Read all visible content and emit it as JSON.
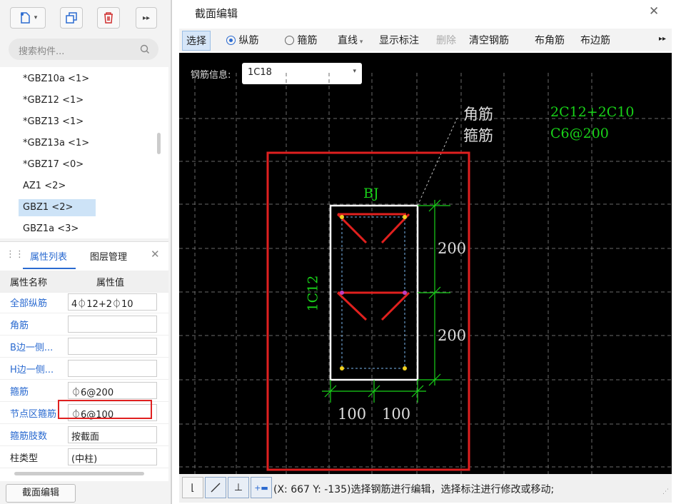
{
  "left": {
    "search_placeholder": "搜索构件...",
    "items": [
      "*GBZ10a <1>",
      "*GBZ12 <1>",
      "*GBZ13 <1>",
      "*GBZ13a <1>",
      "*GBZ17 <0>",
      "AZ1 <2>",
      "GBZ1 <2>",
      "GBZ1a <3>"
    ],
    "tabs": {
      "props": "属性列表",
      "layers": "图层管理"
    },
    "headers": {
      "name": "属性名称",
      "value": "属性值"
    },
    "rows": [
      {
        "name": "全部纵筋",
        "value": "4⏀12+2⏀10"
      },
      {
        "name": "角筋",
        "value": ""
      },
      {
        "name": "B边一侧...",
        "value": ""
      },
      {
        "name": "H边一侧...",
        "value": ""
      },
      {
        "name": "箍筋",
        "value": "⏀6@200"
      },
      {
        "name": "节点区箍筋",
        "value": "⏀6@100"
      },
      {
        "name": "箍筋肢数",
        "value": "按截面"
      },
      {
        "name": "柱类型",
        "value": "(中柱)"
      }
    ],
    "bottom_button": "截面编辑"
  },
  "dialog": {
    "title": "截面编辑",
    "toolbar": {
      "select": "选择",
      "longitudinal": "纵筋",
      "stirrup": "箍筋",
      "line": "直线",
      "show_label": "显示标注",
      "delete": "删除",
      "clear": "清空钢筋",
      "corner": "布角筋",
      "edge": "布边筋"
    },
    "rebar_info_label": "钢筋信息:",
    "rebar_info_value": "1C18",
    "canvas": {
      "corner_label": "角筋",
      "corner_value": "2C12+2C10",
      "stirrup_label": "箍筋",
      "stirrup_value": "C6@200",
      "bj": "BJ",
      "side_label": "1C12",
      "dim_200a": "200",
      "dim_200b": "200",
      "dim_100a": "100",
      "dim_100b": "100"
    },
    "status_text": "(X: 667 Y: -135)选择钢筋进行编辑，选择标注进行修改或移动;"
  },
  "colors": {
    "accent": "#2a6ad0",
    "highlight": "#e02020",
    "green": "#19d219",
    "rebar": "#e0201e"
  }
}
